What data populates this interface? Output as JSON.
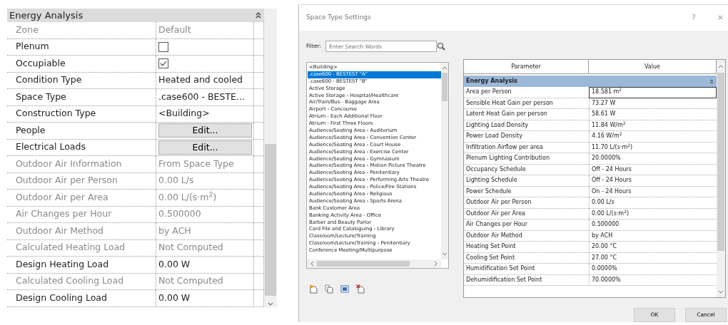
{
  "properties": {
    "header": "Energy Analysis",
    "rows": [
      {
        "label": "Zone",
        "kind": "text",
        "value": "Default",
        "disabled": true
      },
      {
        "label": "Plenum",
        "kind": "checkbox",
        "checked": false,
        "disabled": false
      },
      {
        "label": "Occupiable",
        "kind": "checkbox",
        "checked": true,
        "disabled": false
      },
      {
        "label": "Condition Type",
        "kind": "text",
        "value": "Heated and cooled",
        "disabled": false
      },
      {
        "label": "Space Type",
        "kind": "text",
        "value": ".case600 - BESTE...",
        "disabled": false
      },
      {
        "label": "Construction Type",
        "kind": "text",
        "value": "<Building>",
        "disabled": false
      },
      {
        "label": "People",
        "kind": "button",
        "value": "Edit...",
        "disabled": false
      },
      {
        "label": "Electrical Loads",
        "kind": "button",
        "value": "Edit...",
        "disabled": false
      },
      {
        "label": "Outdoor Air Information",
        "kind": "text",
        "value": "From Space Type",
        "disabled": true
      },
      {
        "label": "Outdoor Air per Person",
        "kind": "text",
        "value": "0.00 L/s",
        "disabled": true
      },
      {
        "label": "Outdoor Air per Area",
        "kind": "text",
        "value": "0.00 L/(s·m$^{2}$)",
        "disabled": true
      },
      {
        "label": "Air Changes per Hour",
        "kind": "text",
        "value": "0.500000",
        "disabled": true
      },
      {
        "label": "Outdoor Air Method",
        "kind": "text",
        "value": "by ACH",
        "disabled": true
      },
      {
        "label": "Calculated Heating Load",
        "kind": "text",
        "value": "Not Computed",
        "disabled": true
      },
      {
        "label": "Design Heating Load",
        "kind": "text",
        "value": "0.00 W",
        "disabled": false
      },
      {
        "label": "Calculated Cooling Load",
        "kind": "text",
        "value": "Not Computed",
        "disabled": true
      },
      {
        "label": "Design Cooling Load",
        "kind": "text",
        "value": "0.00 W",
        "disabled": false
      }
    ]
  },
  "dialog": {
    "title": "Space Type Settings",
    "help": "?",
    "close": "×",
    "filter": {
      "label": "Filter:",
      "placeholder": "Enter Search Words"
    },
    "space_types": [
      {
        "label": "<Building>",
        "selected": false
      },
      {
        "label": ".case600 - BESTEST \"A\"",
        "selected": true
      },
      {
        "label": ".case600 - BESTEST \"B\"",
        "selected": false
      },
      {
        "label": "Active Storage",
        "selected": false
      },
      {
        "label": "Active Storage - Hospital/Healthcare",
        "selected": false
      },
      {
        "label": "Air/Train/Bus - Baggage Area",
        "selected": false
      },
      {
        "label": "Airport - Concourse",
        "selected": false
      },
      {
        "label": "Atrium - Each Additional Floor",
        "selected": false
      },
      {
        "label": "Atrium - First Three Floors",
        "selected": false
      },
      {
        "label": "Audience/Seating Area - Auditorium",
        "selected": false
      },
      {
        "label": "Audience/Seating Area - Convention Center",
        "selected": false
      },
      {
        "label": "Audience/Seating Area - Court House",
        "selected": false
      },
      {
        "label": "Audience/Seating Area - Exercise Center",
        "selected": false
      },
      {
        "label": "Audience/Seating Area - Gymnasium",
        "selected": false
      },
      {
        "label": "Audience/Seating Area - Motion Picture Theatre",
        "selected": false
      },
      {
        "label": "Audience/Seating Area - Penitentiary",
        "selected": false
      },
      {
        "label": "Audience/Seating Area - Performing Arts Theatre",
        "selected": false
      },
      {
        "label": "Audience/Seating Area - Police/Fire Stations",
        "selected": false
      },
      {
        "label": "Audience/Seating Area - Religious",
        "selected": false
      },
      {
        "label": "Audience/Seating Area - Sports Arena",
        "selected": false
      },
      {
        "label": "Bank Customer Area",
        "selected": false
      },
      {
        "label": "Banking Activity Area - Office",
        "selected": false
      },
      {
        "label": "Barber and Beauty Parlor",
        "selected": false
      },
      {
        "label": "Card File and Cataloguing - Library",
        "selected": false
      },
      {
        "label": "Classroom/Lecture/Training",
        "selected": false
      },
      {
        "label": "Classroom/Lecture/Training - Penitentiary",
        "selected": false
      },
      {
        "label": "Conference Meeting/Multipurpose",
        "selected": false
      }
    ],
    "table": {
      "columns": [
        "Parameter",
        "Value"
      ],
      "group": "Energy Analysis",
      "rows": [
        {
          "parameter": "Area per Person",
          "value": "18.581 m$^{2}$",
          "selected": true
        },
        {
          "parameter": "Sensible Heat Gain per person",
          "value": "73.27 W",
          "selected": false
        },
        {
          "parameter": "Latent Heat Gain per person",
          "value": "58.61 W",
          "selected": false
        },
        {
          "parameter": "Lighting Load Density",
          "value": "11.84 W/m$^{2}$",
          "selected": false
        },
        {
          "parameter": "Power Load Density",
          "value": "4.16 W/m$^{2}$",
          "selected": false
        },
        {
          "parameter": "Infiltration Airflow per area",
          "value": "11.70 L/(s·m$^{2}$)",
          "selected": false
        },
        {
          "parameter": "Plenum Lighting Contribution",
          "value": "20.0000%",
          "selected": false
        },
        {
          "parameter": "Occupancy Schedule",
          "value": "Off - 24 Hours",
          "selected": false
        },
        {
          "parameter": "Lighting Schedule",
          "value": "Off - 24 Hours",
          "selected": false
        },
        {
          "parameter": "Power Schedule",
          "value": "On - 24 Hours",
          "selected": false
        },
        {
          "parameter": "Outdoor Air per Person",
          "value": "0.00 L/s",
          "selected": false
        },
        {
          "parameter": "Outdoor Air per Area",
          "value": "0.00 L/(s·m$^{2}$)",
          "selected": false
        },
        {
          "parameter": "Air Changes per Hour",
          "value": "0.500000",
          "selected": false
        },
        {
          "parameter": "Outdoor Air Method",
          "value": "by ACH",
          "selected": false
        },
        {
          "parameter": "Heating Set Point",
          "value": "20.00 °C",
          "selected": false
        },
        {
          "parameter": "Cooling Set Point",
          "value": "27.00 °C",
          "selected": false
        },
        {
          "parameter": "Humidification Set Point",
          "value": "0.0000%",
          "selected": false
        },
        {
          "parameter": "Dehumidification Set Point",
          "value": "70.0000%",
          "selected": false
        }
      ]
    },
    "buttons": [
      "OK",
      "Cancel"
    ]
  }
}
